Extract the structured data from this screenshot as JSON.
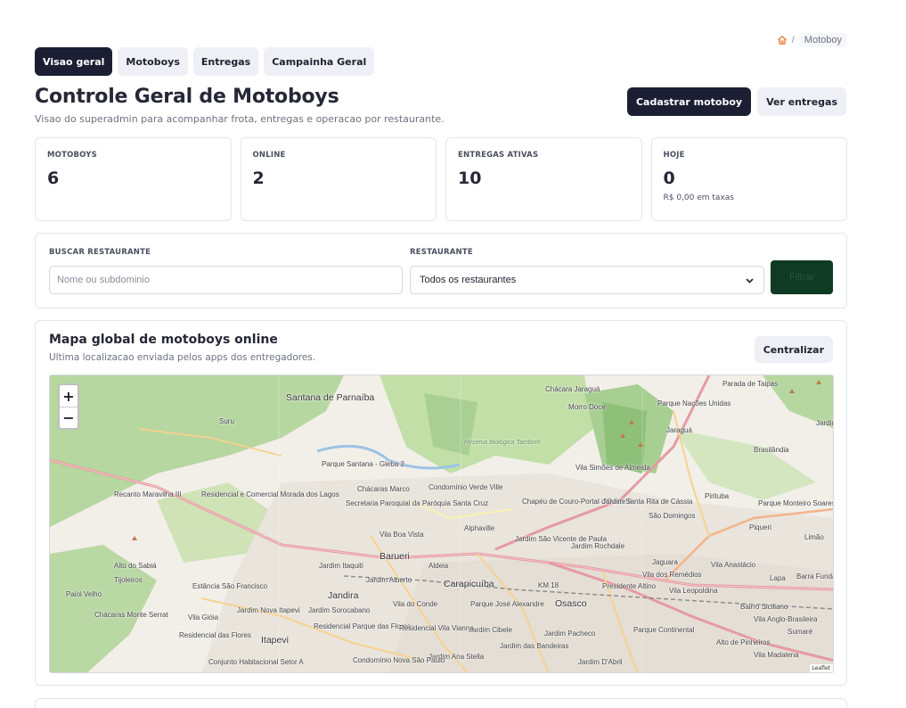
{
  "breadcrumb": {
    "home_icon": "home-icon",
    "separator": "/",
    "current": "Motoboy"
  },
  "tabs": [
    {
      "label": "Visao geral",
      "active": true
    },
    {
      "label": "Motoboys",
      "active": false
    },
    {
      "label": "Entregas",
      "active": false
    },
    {
      "label": "Campainha Geral",
      "active": false
    }
  ],
  "header": {
    "title": "Controle Geral de Motoboys",
    "subtitle": "Visao do superadmin para acompanhar frota, entregas e operacao por restaurante.",
    "primary_button": "Cadastrar motoboy",
    "secondary_button": "Ver entregas"
  },
  "stats": [
    {
      "label": "MOTOBOYS",
      "value": "6",
      "note": ""
    },
    {
      "label": "ONLINE",
      "value": "2",
      "note": ""
    },
    {
      "label": "ENTREGAS ATIVAS",
      "value": "10",
      "note": ""
    },
    {
      "label": "HOJE",
      "value": "0",
      "note": "R$ 0,00 em taxas"
    }
  ],
  "filter": {
    "search_label": "BUSCAR RESTAURANTE",
    "search_placeholder": "Nome ou subdominio",
    "select_label": "RESTAURANTE",
    "select_value": "Todos os restaurantes",
    "button": "Filtrar"
  },
  "map_section": {
    "title": "Mapa global de motoboys online",
    "subtitle": "Ultima localizacao enviada pelos apps dos entregadores.",
    "center_button": "Centralizar",
    "zoom_in": "+",
    "zoom_out": "−",
    "attribution": "Leaflet"
  },
  "map_labels": [
    "Santana de Parnaíba",
    "Suru",
    "Parque Santana - Gleba 2",
    "Chácaras Marco",
    "Condomínio Verde Ville",
    "Secretaria Paroquial da Paróquia Santa Cruz",
    "Recanto Maravilha III",
    "Residencial e Comercial Morada dos Lagos",
    "Alphaville",
    "Vila Boa Vista",
    "Barueri",
    "Aldeia",
    "Jardim Itaquiti",
    "Jardim Alberto",
    "Alto do Sabiá",
    "Tijoleiros",
    "Estância São Francisco",
    "Jandira",
    "Carapicuíba",
    "Paiol Velho",
    "Chácaras Monte Serrat",
    "Vila Gióia",
    "Jardim Nova Itapevi",
    "Jardim Sorocabano",
    "Vila do Conde",
    "Parque José Alexandre",
    "Osasco",
    "Itapevi",
    "Residencial Parque das Flores",
    "Residencial das Flores",
    "Jardim Cibele",
    "Jardim Pacheco",
    "Residencial Vila Vianna",
    "Jardim das Bandeiras",
    "Jardim Ana Stella",
    "Conjunto Habitacional Setor A",
    "Condomínio Nova São Paulo",
    "Parque Continental",
    "Jardim D'Abril",
    "Chácara Jaraguá",
    "Morro Doce",
    "Vila Simões de Almeida",
    "Chapéu de Couro-Portal d'Oeste II",
    "Jardim Santa Rita de Cássia",
    "Jardim São Vicente de Paula",
    "Jardim Rochdale",
    "Presidente Altino",
    "Vila dos Remédios",
    "Vila Leopoldina",
    "São Domingos",
    "Pirituba",
    "Piqueri",
    "Jaguara",
    "Vila Anastácio",
    "Lapa",
    "Barra Funda",
    "Parque Nações Unidas",
    "Jaraguá",
    "Parada de Taipas",
    "Brasilândia",
    "Parque Monteiro Soares",
    "Limão",
    "Bairro Siciliano",
    "Vila Anglo-Brasileira",
    "Sumaré",
    "Alto de Pinheiros",
    "Vila Madalena",
    "Reserva Biológica Tamboré",
    "Jardim Julio",
    "KM 18"
  ],
  "colors": {
    "primary_dark": "#1c1f33",
    "filter_button": "#0f3a23",
    "light_button": "#eef0f6",
    "breadcrumb_home": "#e8732b"
  }
}
